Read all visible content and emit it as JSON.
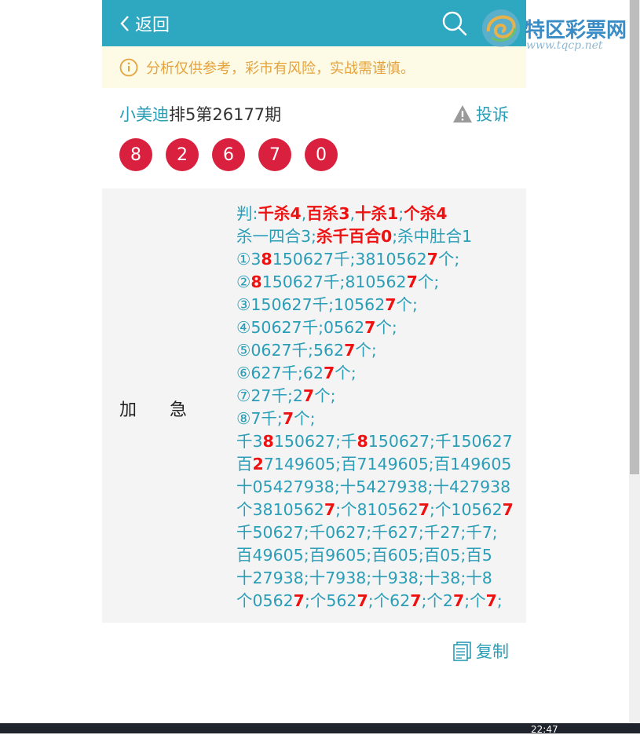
{
  "header": {
    "back_label": "返回"
  },
  "notice": {
    "text": "分析仅供参考，彩市有风险，实战需谨慎。"
  },
  "period": {
    "author": "小美迪",
    "title": "排5第26177期",
    "complain_label": "投诉"
  },
  "balls": [
    "8",
    "2",
    "6",
    "7",
    "0"
  ],
  "card": {
    "label_left": "加",
    "label_right": "急",
    "lines": [
      [
        [
          "判:",
          ""
        ],
        [
          "千杀4",
          "r"
        ],
        [
          ",",
          ""
        ],
        [
          "百杀3",
          "r"
        ],
        [
          ",",
          ""
        ],
        [
          "十杀1",
          "r"
        ],
        [
          ";",
          ""
        ],
        [
          "个杀4",
          "r"
        ]
      ],
      [
        [
          "杀一四合3;",
          ""
        ],
        [
          "杀千百合0",
          "r"
        ],
        [
          ";杀中肚合1",
          ""
        ]
      ],
      [
        [
          "①3",
          ""
        ],
        [
          "8",
          "r"
        ],
        [
          "150627千;381056",
          ""
        ],
        [
          "2",
          ""
        ],
        [
          "7",
          "r"
        ],
        [
          "个;",
          ""
        ]
      ],
      [
        [
          "②",
          ""
        ],
        [
          "8",
          "r"
        ],
        [
          "150627千;810562",
          ""
        ],
        [
          "7",
          "r"
        ],
        [
          "个;",
          ""
        ]
      ],
      [
        [
          "③150627千;10562",
          ""
        ],
        [
          "7",
          "r"
        ],
        [
          "个;",
          ""
        ]
      ],
      [
        [
          "④50627千;0562",
          ""
        ],
        [
          "7",
          "r"
        ],
        [
          "个;",
          ""
        ]
      ],
      [
        [
          "⑤0627千;562",
          ""
        ],
        [
          "7",
          "r"
        ],
        [
          "个;",
          ""
        ]
      ],
      [
        [
          "⑥627千;62",
          ""
        ],
        [
          "7",
          "r"
        ],
        [
          "个;",
          ""
        ]
      ],
      [
        [
          "⑦27千;2",
          ""
        ],
        [
          "7",
          "r"
        ],
        [
          "个;",
          ""
        ]
      ],
      [
        [
          "⑧7千;",
          ""
        ],
        [
          "7",
          "r"
        ],
        [
          "个;",
          ""
        ]
      ],
      [
        [
          "千3",
          ""
        ],
        [
          "8",
          "r"
        ],
        [
          "150627;千",
          ""
        ],
        [
          "8",
          "r"
        ],
        [
          "150627;千150627",
          ""
        ]
      ],
      [
        [
          "百",
          ""
        ],
        [
          "2",
          "r"
        ],
        [
          "7149605;百7149605;百149605",
          ""
        ]
      ],
      [
        [
          "十05427938;十5427938;十427938",
          ""
        ]
      ],
      [
        [
          "个381056",
          ""
        ],
        [
          "2",
          ""
        ],
        [
          "7",
          "r"
        ],
        [
          ";个810562",
          ""
        ],
        [
          "7",
          "r"
        ],
        [
          ";个10562",
          ""
        ],
        [
          "7",
          "r"
        ]
      ],
      [
        [
          "千50627;千0627;千627;千27;千7;",
          ""
        ]
      ],
      [
        [
          "百49605;百9605;百605;百05;百5",
          ""
        ]
      ],
      [
        [
          "十27938;十7938;十938;十38;十8",
          ""
        ]
      ],
      [
        [
          "个0562",
          ""
        ],
        [
          "7",
          "r"
        ],
        [
          ";个562",
          ""
        ],
        [
          "7",
          "r"
        ],
        [
          ";个62",
          ""
        ],
        [
          "7",
          "r"
        ],
        [
          ";个2",
          ""
        ],
        [
          "7",
          "r"
        ],
        [
          ";个",
          ""
        ],
        [
          "7",
          "r"
        ],
        [
          ";",
          ""
        ]
      ]
    ]
  },
  "copy": {
    "label": "复制"
  },
  "logo": {
    "name": "特区彩票网",
    "url": "www.tqcp.net"
  },
  "taskbar": {
    "clock": "22:47"
  },
  "colors": {
    "primary": "#2ea7c0",
    "ball": "#d9213f",
    "highlight": "#ee1111",
    "notice": "#e6a23c"
  },
  "icons": [
    "chevron-left-icon",
    "search-icon",
    "info-icon",
    "warning-icon",
    "copy-icon"
  ]
}
